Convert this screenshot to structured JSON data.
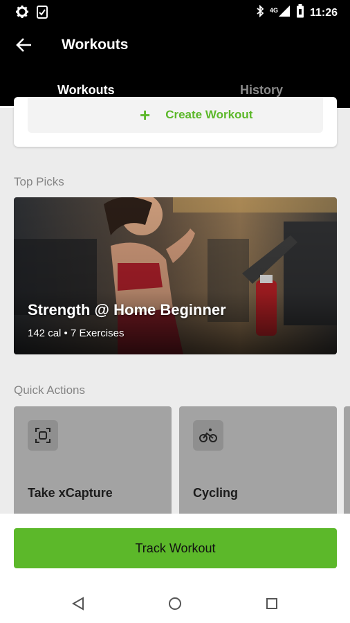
{
  "status_bar": {
    "time": "11:26",
    "network": "4G",
    "icons": [
      "gear-icon",
      "clipboard-check-icon",
      "bluetooth-icon",
      "signal-icon",
      "battery-icon"
    ]
  },
  "app_bar": {
    "title": "Workouts",
    "back_icon": "arrow-left-icon"
  },
  "tabs": [
    {
      "label": "Workouts",
      "active": true
    },
    {
      "label": "History",
      "active": false
    }
  ],
  "create_workout": {
    "label": "Create Workout",
    "icon": "plus-icon"
  },
  "top_picks": {
    "section_title": "Top Picks",
    "card": {
      "title": "Strength @ Home Beginner",
      "subtitle": "142 cal • 7 Exercises"
    }
  },
  "quick_actions": {
    "section_title": "Quick Actions",
    "items": [
      {
        "label": "Take xCapture",
        "icon": "capture-frame-icon"
      },
      {
        "label": "Cycling",
        "icon": "bicycle-icon"
      }
    ]
  },
  "track_button": {
    "label": "Track Workout"
  },
  "colors": {
    "accent": "#5cb82a",
    "app_bar": "#000000",
    "background": "#ececec",
    "quick_action_card": "#a3a3a3"
  }
}
